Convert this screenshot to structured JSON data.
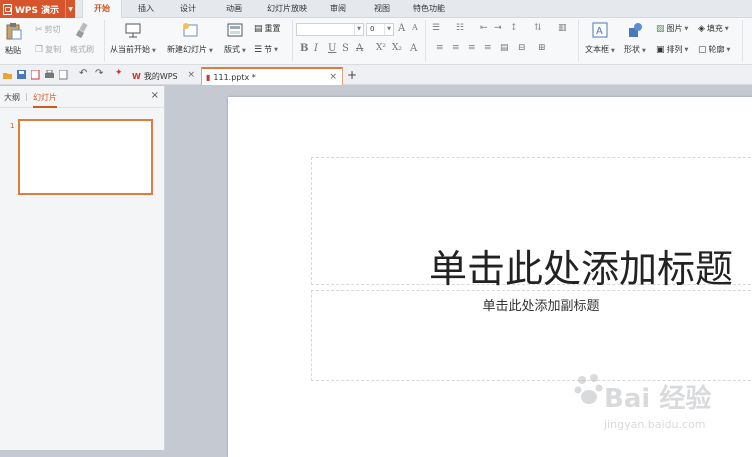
{
  "app": {
    "name": "WPS 演示"
  },
  "menu": {
    "tabs": [
      "开始",
      "插入",
      "设计",
      "动画",
      "幻灯片放映",
      "审阅",
      "视图",
      "特色功能"
    ],
    "active": "开始"
  },
  "ribbon": {
    "paste": "粘贴",
    "cut": "剪切",
    "copy": "复制",
    "format_painter": "格式刷",
    "from_current": "从当前开始",
    "new_slide": "新建幻灯片",
    "layout": "版式",
    "reset": "重置",
    "section": "节",
    "font_size": "0",
    "text_box": "文本框",
    "shape": "形状",
    "picture": "图片",
    "fill": "填充",
    "arrange": "排列",
    "outline": "轮廓"
  },
  "tabs": {
    "home_tab": "我的WPS",
    "doc_tab": "111.pptx *",
    "add": "+"
  },
  "sidepanel": {
    "outline_tab": "大纲",
    "slides_tab": "幻灯片",
    "slide_number": "1"
  },
  "slide": {
    "title_placeholder": "单击此处添加标题",
    "subtitle_placeholder": "单击此处添加副标题"
  },
  "watermark": {
    "brand": "Bai 经验",
    "url": "jingyan.baidu.com"
  },
  "colors": {
    "accent": "#d7552a",
    "menubar": "#e5e8ed",
    "ribbon": "#f7f8fa",
    "workspace": "#c5c9d1"
  }
}
